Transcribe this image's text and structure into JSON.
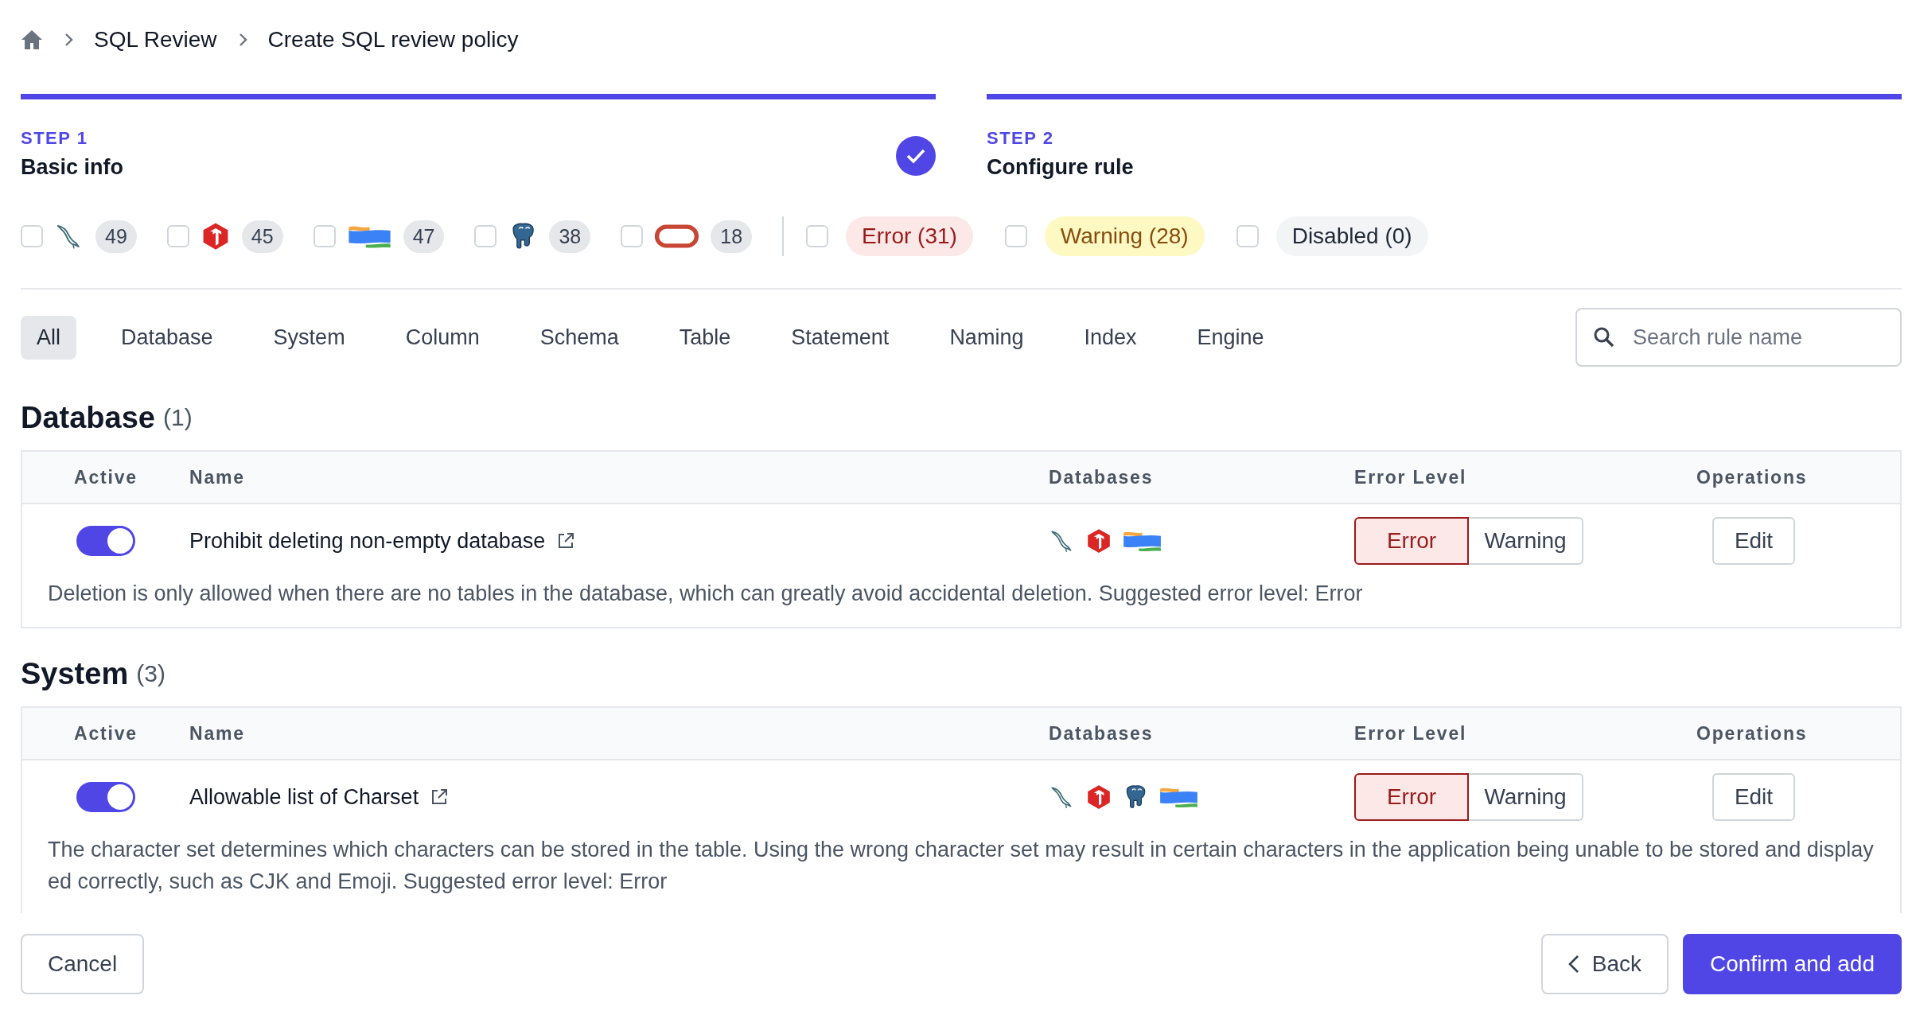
{
  "breadcrumb": [
    "SQL Review",
    "Create SQL review policy"
  ],
  "steps": [
    {
      "label": "STEP 1",
      "title": "Basic info",
      "completed": true
    },
    {
      "label": "STEP 2",
      "title": "Configure rule",
      "completed": false
    }
  ],
  "engine_filters": [
    {
      "kind": "mysql",
      "count": "49",
      "checked": false
    },
    {
      "kind": "tidb",
      "count": "45",
      "checked": false
    },
    {
      "kind": "oceanbase",
      "count": "47",
      "checked": false
    },
    {
      "kind": "postgres",
      "count": "38",
      "checked": false
    },
    {
      "kind": "oracle",
      "count": "18",
      "checked": false
    }
  ],
  "level_filters": [
    {
      "kind": "error",
      "label": "Error (31)",
      "checked": false
    },
    {
      "kind": "warning",
      "label": "Warning (28)",
      "checked": false
    },
    {
      "kind": "disabled",
      "label": "Disabled (0)",
      "checked": false
    }
  ],
  "tabs": [
    {
      "label": "All",
      "selected": true
    },
    {
      "label": "Database",
      "selected": false
    },
    {
      "label": "System",
      "selected": false
    },
    {
      "label": "Column",
      "selected": false
    },
    {
      "label": "Schema",
      "selected": false
    },
    {
      "label": "Table",
      "selected": false
    },
    {
      "label": "Statement",
      "selected": false
    },
    {
      "label": "Naming",
      "selected": false
    },
    {
      "label": "Index",
      "selected": false
    },
    {
      "label": "Engine",
      "selected": false
    }
  ],
  "search": {
    "placeholder": "Search rule name"
  },
  "sections": [
    {
      "title": "Database",
      "count": "(1)",
      "columns": [
        "Active",
        "Name",
        "Databases",
        "Error Level",
        "Operations"
      ],
      "rules": [
        {
          "active": true,
          "name": "Prohibit deleting non-empty database",
          "engines": [
            {
              "kind": "mysql"
            },
            {
              "kind": "tidb"
            },
            {
              "kind": "oceanbase"
            }
          ],
          "levels": [
            {
              "label": "Error",
              "selected": true
            },
            {
              "label": "Warning",
              "selected": false
            }
          ],
          "operation": "Edit",
          "description": "Deletion is only allowed when there are no tables in the database, which can greatly avoid accidental deletion. Suggested error level: Error"
        }
      ]
    },
    {
      "title": "System",
      "count": "(3)",
      "columns": [
        "Active",
        "Name",
        "Databases",
        "Error Level",
        "Operations"
      ],
      "rules": [
        {
          "active": true,
          "name": "Allowable list of Charset",
          "engines": [
            {
              "kind": "mysql"
            },
            {
              "kind": "tidb"
            },
            {
              "kind": "postgres"
            },
            {
              "kind": "oceanbase"
            }
          ],
          "levels": [
            {
              "label": "Error",
              "selected": true
            },
            {
              "label": "Warning",
              "selected": false
            }
          ],
          "operation": "Edit",
          "description": "The character set determines which characters can be stored in the table. Using the wrong character set may result in certain characters in the application being unable to be stored and displayed correctly, such as CJK and Emoji. Suggested error level: Error"
        }
      ]
    }
  ],
  "footer": {
    "cancel": "Cancel",
    "back": "Back",
    "confirm": "Confirm and add"
  }
}
